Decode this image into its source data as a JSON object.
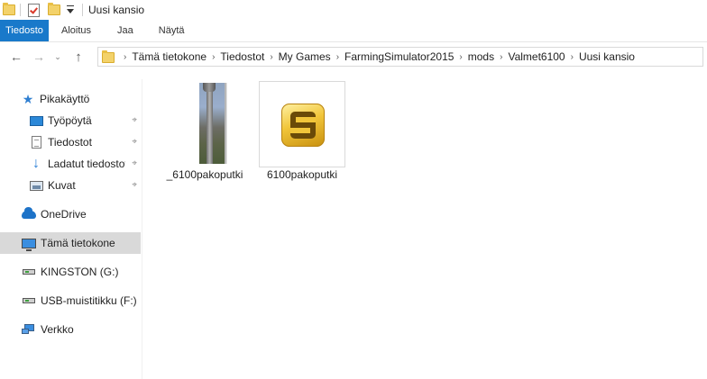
{
  "window": {
    "title": "Uusi kansio"
  },
  "ribbon": {
    "tabs": [
      {
        "label": "Tiedosto"
      },
      {
        "label": "Aloitus"
      },
      {
        "label": "Jaa"
      },
      {
        "label": "Näytä"
      }
    ]
  },
  "address": {
    "crumbs": [
      "Tämä tietokone",
      "Tiedostot",
      "My Games",
      "FarmingSimulator2015",
      "mods",
      "Valmet6100",
      "Uusi kansio"
    ]
  },
  "sidebar": {
    "items": [
      {
        "label": "Pikakäyttö",
        "icon": "star-icon"
      },
      {
        "label": "Työpöytä",
        "icon": "desktop-icon",
        "pinned": true
      },
      {
        "label": "Tiedostot",
        "icon": "documents-icon",
        "pinned": true
      },
      {
        "label": "Ladatut tiedostot",
        "icon": "download-icon",
        "pinned": true
      },
      {
        "label": "Kuvat",
        "icon": "pictures-icon",
        "pinned": true
      },
      {
        "label": "OneDrive",
        "icon": "cloud-icon"
      },
      {
        "label": "Tämä tietokone",
        "icon": "computer-icon",
        "selected": true
      },
      {
        "label": "KINGSTON (G:)",
        "icon": "drive-icon"
      },
      {
        "label": "USB-muistitikku (F:)",
        "icon": "drive-icon"
      },
      {
        "label": "Verkko",
        "icon": "network-icon"
      }
    ]
  },
  "files": [
    {
      "name": "_6100pakoputki",
      "icon": "image-thumbnail"
    },
    {
      "name": "6100pakoputki",
      "icon": "gold-s-app-icon"
    }
  ]
}
